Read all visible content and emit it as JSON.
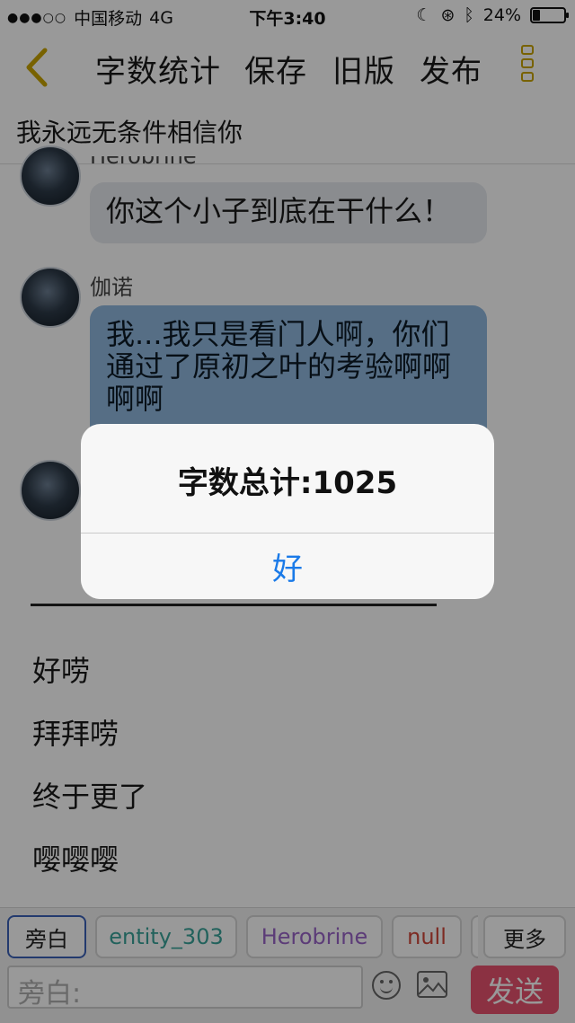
{
  "status_bar": {
    "carrier": "中国移动",
    "network": "4G",
    "time": "下午3:40",
    "battery": "24%",
    "battery_level": 0.24
  },
  "navbar": {
    "word_count_label": "字数统计",
    "save_label": "保存",
    "old_version_label": "旧版",
    "publish_label": "发布",
    "back_icon": "chevron-left-icon",
    "menu_icon": "more-vertical-icon"
  },
  "document": {
    "title": "我永远无条件相信你"
  },
  "messages": [
    {
      "sender": "Herobrine",
      "text": "你这个小子到底在干什么！",
      "style": "grey"
    },
    {
      "sender": "伽诺",
      "text": "我...我只是看门人啊，你们通过了原初之叶的考验啊啊啊啊",
      "style": "blue"
    }
  ],
  "plain_lines": [
    "好唠",
    "拜拜唠",
    "终于更了",
    "嘤嘤嘤"
  ],
  "role_chips": [
    {
      "label": "旁白",
      "color": "#222222"
    },
    {
      "label": "entity_303",
      "color": "#3aa39a"
    },
    {
      "label": "Herobrine",
      "color": "#9a64c8"
    },
    {
      "label": "null",
      "color": "#d0463a"
    },
    {
      "label": "更多",
      "color": "#222222"
    }
  ],
  "composer": {
    "placeholder": "旁白:",
    "send_label": "发送",
    "emoji_icon": "emoji-icon",
    "image_icon": "image-icon"
  },
  "alert": {
    "title": "字数总计:1025",
    "ok_label": "好"
  }
}
